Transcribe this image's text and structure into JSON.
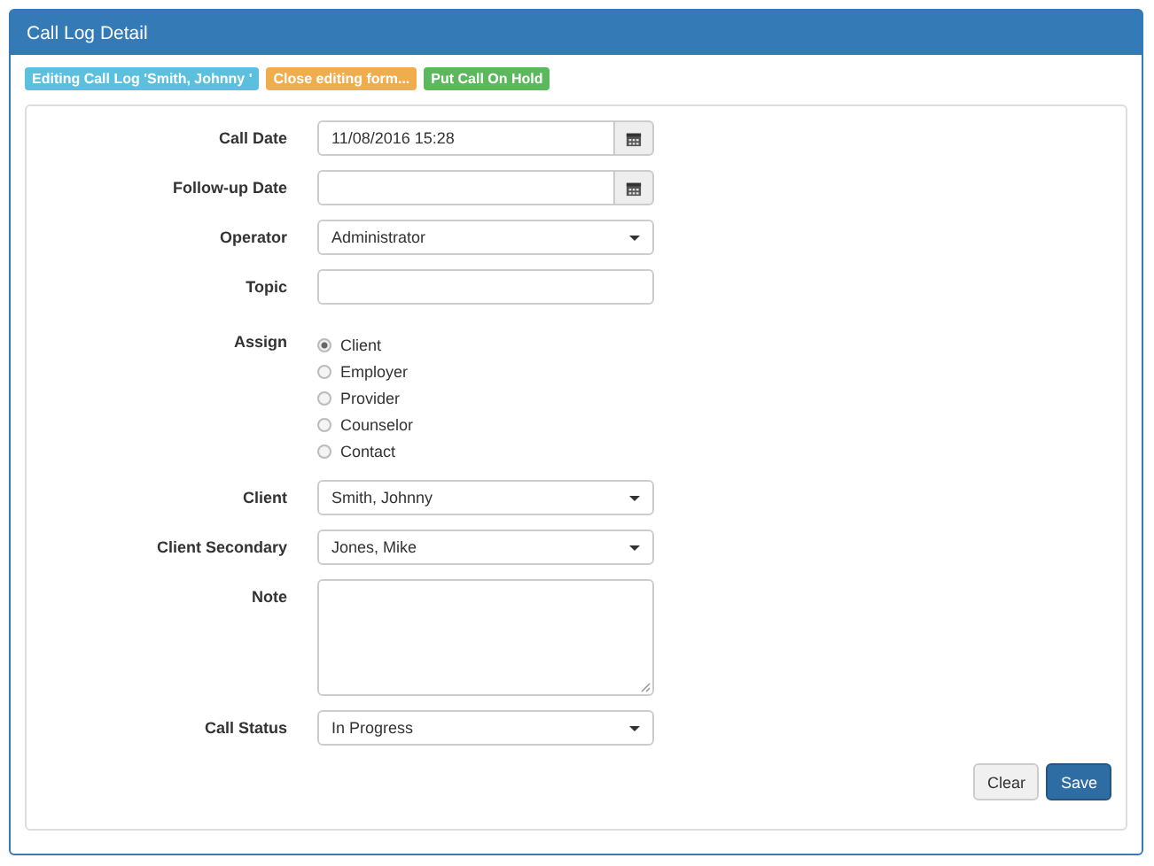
{
  "panel": {
    "title": "Call Log Detail"
  },
  "badges": [
    {
      "label": "Editing Call Log 'Smith, Johnny '",
      "color": "#5bc0de"
    },
    {
      "label": "Close editing form...",
      "color": "#f0ad4e"
    },
    {
      "label": "Put Call On Hold",
      "color": "#5cb85c"
    }
  ],
  "fields": [
    {
      "label": "Call Date",
      "kind": "date",
      "value": "11/08/2016 15:28"
    },
    {
      "label": "Follow-up Date",
      "kind": "date"
    },
    {
      "label": "Operator",
      "kind": "select",
      "value": "Administrator"
    },
    {
      "label": "Topic",
      "kind": "text"
    },
    {
      "label": "Assign",
      "kind": "radio",
      "options": [
        {
          "label": "Client",
          "selected": true
        },
        {
          "label": "Employer",
          "selected": false
        },
        {
          "label": "Provider",
          "selected": false
        },
        {
          "label": "Counselor",
          "selected": false
        },
        {
          "label": "Contact",
          "selected": false
        }
      ]
    },
    {
      "label": "Client",
      "kind": "select",
      "value": "Smith, Johnny"
    },
    {
      "label": "Client Secondary",
      "kind": "select",
      "value": "Jones, Mike"
    },
    {
      "label": "Note",
      "kind": "textarea"
    },
    {
      "label": "Call Status",
      "kind": "select",
      "value": "In Progress"
    }
  ],
  "buttons": [
    {
      "label": "Clear",
      "kind": "default"
    },
    {
      "label": "Save",
      "kind": "primary"
    }
  ]
}
